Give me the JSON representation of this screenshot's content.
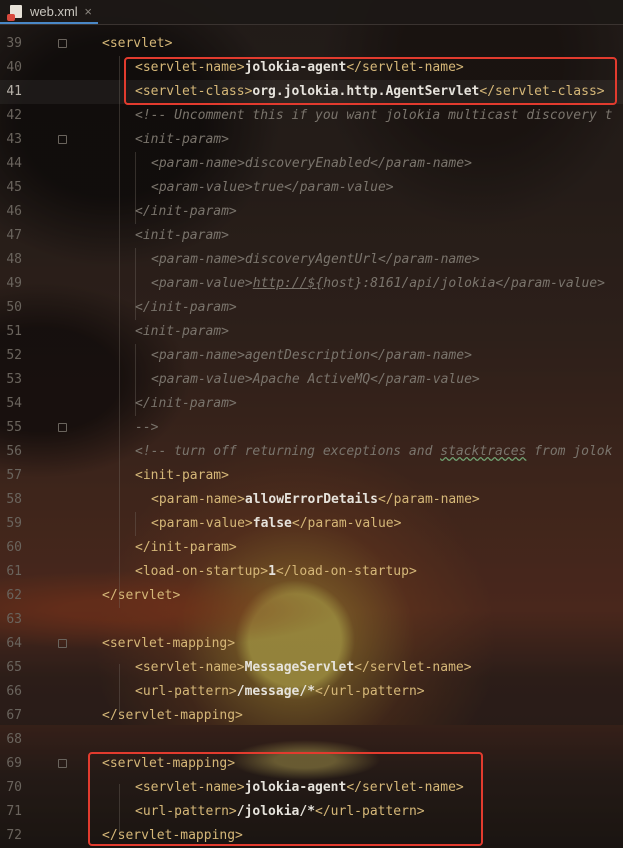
{
  "tab": {
    "label": "web.xml",
    "close": "×"
  },
  "lines": [
    {
      "n": "39",
      "parts": [
        [
          "tag",
          "<servlet>"
        ]
      ]
    },
    {
      "n": "40",
      "parts": [
        [
          "tag",
          "<servlet-name>"
        ],
        [
          "ttext",
          "jolokia-agent"
        ],
        [
          "tag",
          "</servlet-name>"
        ]
      ]
    },
    {
      "n": "41",
      "parts": [
        [
          "tag",
          "<servlet-class>"
        ],
        [
          "ttext",
          "org.jolokia.http.AgentServlet"
        ],
        [
          "tag",
          "</servlet-class>"
        ]
      ]
    },
    {
      "n": "42",
      "parts": [
        [
          "cmt",
          "<!-- Uncomment this if you want jolokia multicast discovery t"
        ]
      ]
    },
    {
      "n": "43",
      "parts": [
        [
          "cmt",
          "<init-param>"
        ]
      ]
    },
    {
      "n": "44",
      "parts": [
        [
          "cmt",
          "<param-name>discoveryEnabled</param-name>"
        ]
      ]
    },
    {
      "n": "45",
      "parts": [
        [
          "cmt",
          "<param-value>true</param-value>"
        ]
      ]
    },
    {
      "n": "46",
      "parts": [
        [
          "cmt",
          "</init-param>"
        ]
      ]
    },
    {
      "n": "47",
      "parts": [
        [
          "cmt",
          "<init-param>"
        ]
      ]
    },
    {
      "n": "48",
      "parts": [
        [
          "cmt",
          "<param-name>discoveryAgentUrl</param-name>"
        ]
      ]
    },
    {
      "n": "49",
      "parts": [
        [
          "cmt",
          "<param-value>"
        ],
        [
          "url",
          "http://${"
        ],
        [
          "cmt",
          "host}:8161/api/jolokia</param-value>"
        ]
      ]
    },
    {
      "n": "50",
      "parts": [
        [
          "cmt",
          "</init-param>"
        ]
      ]
    },
    {
      "n": "51",
      "parts": [
        [
          "cmt",
          "<init-param>"
        ]
      ]
    },
    {
      "n": "52",
      "parts": [
        [
          "cmt",
          "<param-name>agentDescription</param-name>"
        ]
      ]
    },
    {
      "n": "53",
      "parts": [
        [
          "cmt",
          "<param-value>Apache ActiveMQ</param-value>"
        ]
      ]
    },
    {
      "n": "54",
      "parts": [
        [
          "cmt",
          "</init-param>"
        ]
      ]
    },
    {
      "n": "55",
      "parts": [
        [
          "cmt",
          "-->"
        ]
      ]
    },
    {
      "n": "56",
      "parts": [
        [
          "cmt",
          "<!-- turn off returning exceptions and "
        ],
        [
          "typo",
          "stacktraces"
        ],
        [
          "cmt",
          " from jolok"
        ]
      ]
    },
    {
      "n": "57",
      "parts": [
        [
          "tag",
          "<init-param>"
        ]
      ]
    },
    {
      "n": "58",
      "parts": [
        [
          "tag",
          "<param-name>"
        ],
        [
          "ttext",
          "allowErrorDetails"
        ],
        [
          "tag",
          "</param-name>"
        ]
      ]
    },
    {
      "n": "59",
      "parts": [
        [
          "tag",
          "<param-value>"
        ],
        [
          "ttext",
          "false"
        ],
        [
          "tag",
          "</param-value>"
        ]
      ]
    },
    {
      "n": "60",
      "parts": [
        [
          "tag",
          "</init-param>"
        ]
      ]
    },
    {
      "n": "61",
      "parts": [
        [
          "tag",
          "<load-on-startup>"
        ],
        [
          "ttext",
          "1"
        ],
        [
          "tag",
          "</load-on-startup>"
        ]
      ]
    },
    {
      "n": "62",
      "parts": [
        [
          "tag",
          "</servlet>"
        ]
      ]
    },
    {
      "n": "63",
      "parts": []
    },
    {
      "n": "64",
      "parts": [
        [
          "tag",
          "<servlet-mapping>"
        ]
      ]
    },
    {
      "n": "65",
      "parts": [
        [
          "tag",
          "<servlet-name>"
        ],
        [
          "ttext",
          "MessageServlet"
        ],
        [
          "tag",
          "</servlet-name>"
        ]
      ]
    },
    {
      "n": "66",
      "parts": [
        [
          "tag",
          "<url-pattern>"
        ],
        [
          "ttext",
          "/message/*"
        ],
        [
          "tag",
          "</url-pattern>"
        ]
      ]
    },
    {
      "n": "67",
      "parts": [
        [
          "tag",
          "</servlet-mapping>"
        ]
      ]
    },
    {
      "n": "68",
      "parts": []
    },
    {
      "n": "69",
      "parts": [
        [
          "tag",
          "<servlet-mapping>"
        ]
      ]
    },
    {
      "n": "70",
      "parts": [
        [
          "tag",
          "<servlet-name>"
        ],
        [
          "ttext",
          "jolokia-agent"
        ],
        [
          "tag",
          "</servlet-name>"
        ]
      ]
    },
    {
      "n": "71",
      "parts": [
        [
          "tag",
          "<url-pattern>"
        ],
        [
          "ttext",
          "/jolokia/*"
        ],
        [
          "tag",
          "</url-pattern>"
        ]
      ]
    },
    {
      "n": "72",
      "parts": [
        [
          "tag",
          "</servlet-mapping>"
        ]
      ]
    }
  ],
  "current_line": "41",
  "colors": {
    "highlight_box": "#e23b2e",
    "tag": "#d5b778",
    "comment": "#7a746c"
  }
}
